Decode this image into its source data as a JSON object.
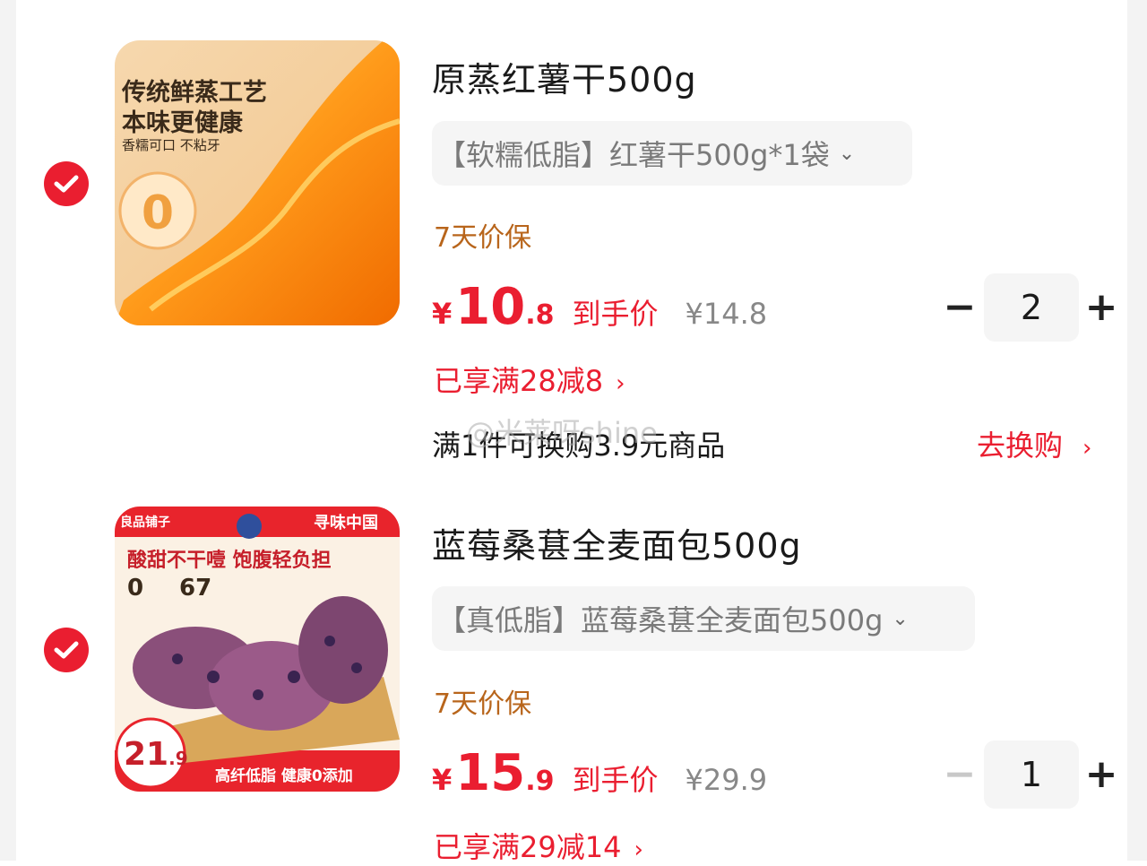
{
  "items": [
    {
      "title": "原蒸红薯干500g",
      "variant": "【软糯低脂】红薯干500g*1袋",
      "guarantee": "7天价保",
      "price_currency": "¥",
      "price_int": "10",
      "price_dec": ".8",
      "price_tag": "到手价",
      "original_price": "¥14.8",
      "quantity": "2",
      "discount": "已享满28减8",
      "swap_text": "满1件可换购3.9元商品",
      "swap_link": "去换购",
      "image": {
        "line1": "传统鲜蒸工艺",
        "line2": "本味更健康",
        "line3": "香糯可口 不粘牙",
        "badge": "0"
      }
    },
    {
      "title": "蓝莓桑葚全麦面包500g",
      "variant": "【真低脂】蓝莓桑葚全麦面包500g",
      "guarantee": "7天价保",
      "price_currency": "¥",
      "price_int": "15",
      "price_dec": ".9",
      "price_tag": "到手价",
      "original_price": "¥29.9",
      "quantity": "1",
      "discount": "已享满29减14",
      "image": {
        "brand": "良品铺子",
        "tagline": "酸甜不干噎 饱腹轻负担",
        "stat1": "0",
        "stat2": "67",
        "price": "21",
        "price_dec": ".9",
        "footer": "高纤低脂 健康0添加",
        "corner": "寻味中国"
      }
    }
  ],
  "watermark": "@米莱呀shine",
  "icons": {
    "check": "check-circle-icon",
    "chevron": "chevron-down-icon",
    "arrow": "chevron-right-icon",
    "minus": "minus-icon",
    "plus": "plus-icon"
  },
  "colors": {
    "accent_red": "#ea1e30",
    "guarantee_orange": "#b8651b",
    "muted_gray": "#888888"
  }
}
